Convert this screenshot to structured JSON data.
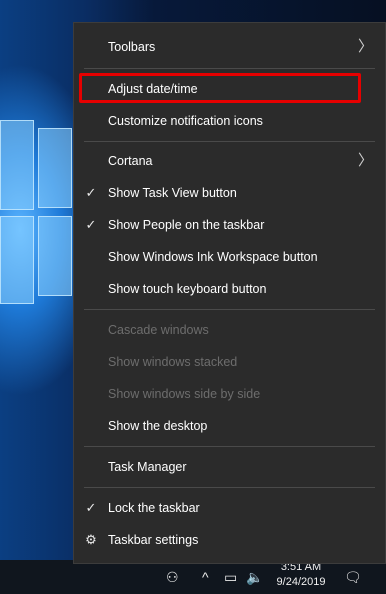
{
  "menu": {
    "items": [
      {
        "label": "Toolbars",
        "submenu": true
      },
      {
        "label": "Adjust date/time"
      },
      {
        "label": "Customize notification icons"
      },
      {
        "label": "Cortana",
        "submenu": true
      },
      {
        "label": "Show Task View button",
        "checked": true
      },
      {
        "label": "Show People on the taskbar",
        "checked": true
      },
      {
        "label": "Show Windows Ink Workspace button"
      },
      {
        "label": "Show touch keyboard button"
      },
      {
        "label": "Cascade windows",
        "disabled": true
      },
      {
        "label": "Show windows stacked",
        "disabled": true
      },
      {
        "label": "Show windows side by side",
        "disabled": true
      },
      {
        "label": "Show the desktop"
      },
      {
        "label": "Task Manager"
      },
      {
        "label": "Lock the taskbar",
        "checked": true
      },
      {
        "label": "Taskbar settings"
      }
    ]
  },
  "glyphs": {
    "check": "✓",
    "arrow": "〉",
    "gear": "⚙"
  },
  "taskbar": {
    "time": "3:51 AM",
    "date": "9/24/2019"
  },
  "colors": {
    "menu_bg": "#2b2b2b",
    "highlight": "#e60000"
  }
}
